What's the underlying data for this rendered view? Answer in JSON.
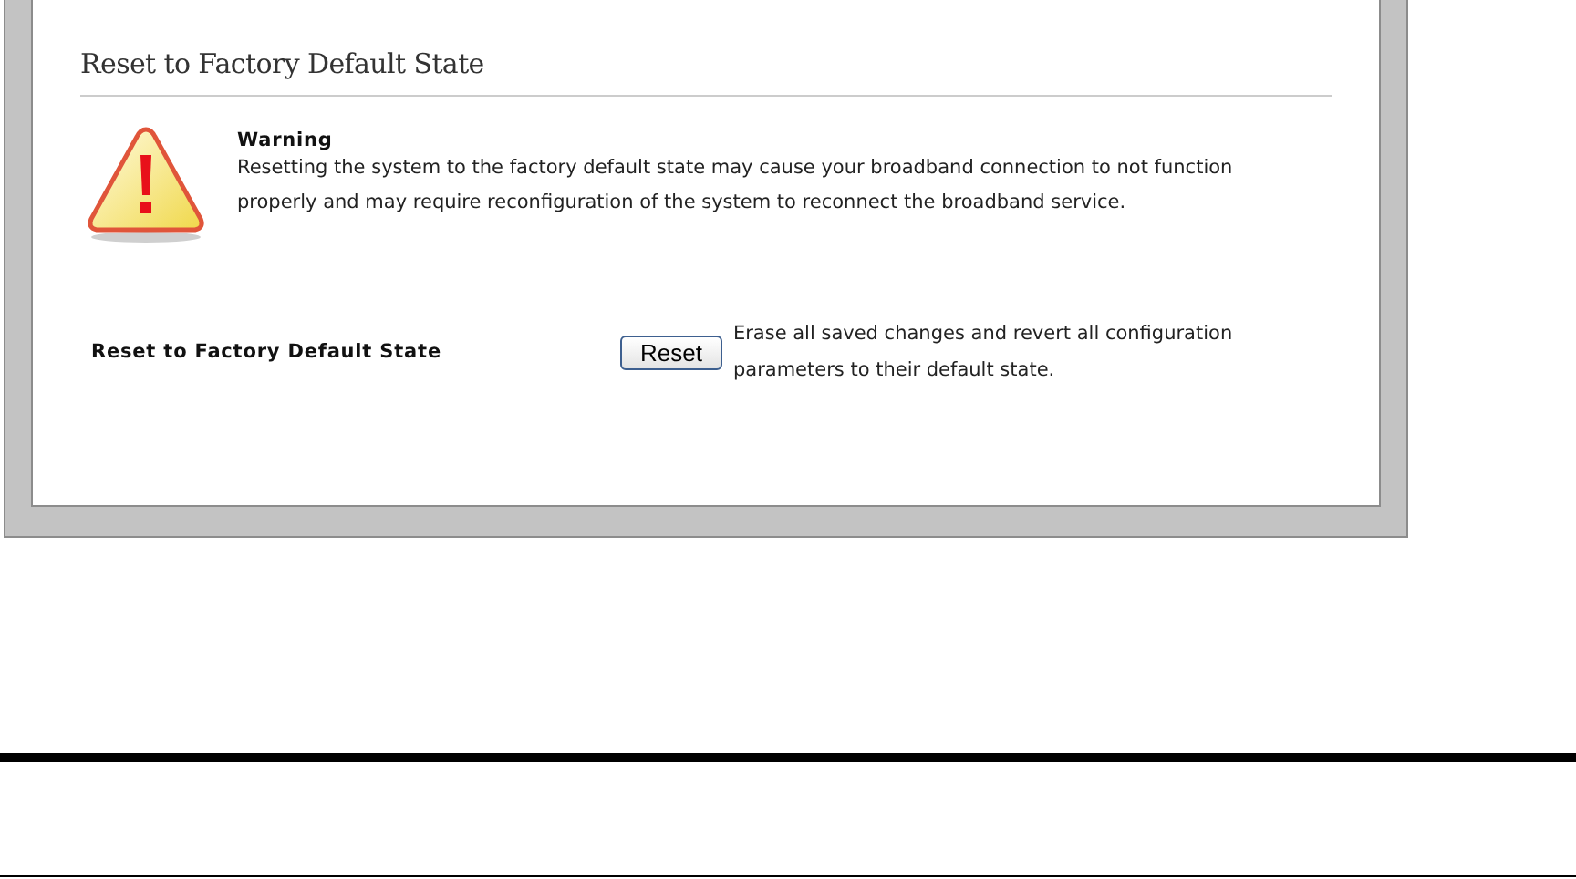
{
  "section": {
    "title": "Reset to Factory Default State"
  },
  "warning": {
    "heading": "Warning",
    "text": "Resetting the system to the factory default state may cause your broadband connection to not function properly and may require reconfiguration of the system to reconnect the broadband service."
  },
  "reset_row": {
    "label": "Reset to Factory Default State",
    "button": "Reset",
    "description": "Erase all saved changes and revert all configuration parameters to their default state."
  }
}
